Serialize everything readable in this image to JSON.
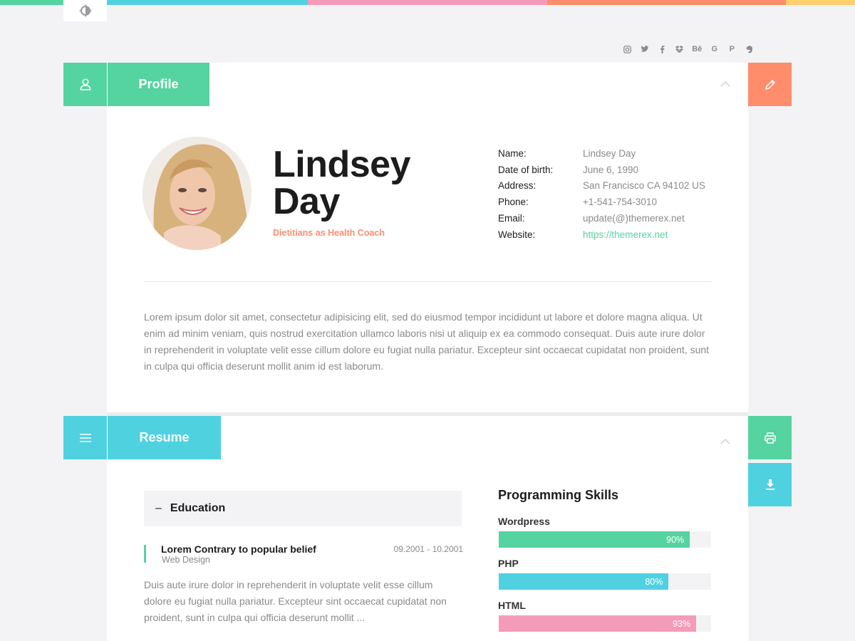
{
  "colors": {
    "green": "#55d3a0",
    "cyan": "#4fd1e0",
    "pink": "#f59bba",
    "orange": "#ff8c6b",
    "yellow": "#ffcf6b"
  },
  "top_bar_segments": [
    "green",
    "white",
    "cyan",
    "pink",
    "orange",
    "yellow"
  ],
  "theme_toggle": {
    "icon": "contrast-icon"
  },
  "socials": [
    "instagram-icon",
    "twitter-icon",
    "facebook-icon",
    "dropbox-icon",
    "behance-icon",
    "google-icon",
    "pinterest-icon",
    "evernote-icon"
  ],
  "socials_text": {
    "behance": "Bē",
    "google": "G",
    "pinterest": "P"
  },
  "profile": {
    "tab_label": "Profile",
    "first_name": "Lindsey",
    "last_name": "Day",
    "role": "Dietitians as Health Coach",
    "info": [
      {
        "key": "Name:",
        "value": "Lindsey Day"
      },
      {
        "key": "Date of birth:",
        "value": "June 6, 1990"
      },
      {
        "key": "Address:",
        "value": "San Francisco CA 94102 US"
      },
      {
        "key": "Phone:",
        "value": "+1-541-754-3010"
      },
      {
        "key": "Email:",
        "value": "update(@)themerex.net"
      },
      {
        "key": "Website:",
        "value": "https://themerex.net"
      }
    ],
    "bio": "Lorem ipsum dolor sit amet, consectetur adipisicing elit, sed do eiusmod tempor incididunt ut labore et dolore magna aliqua. Ut enim ad minim veniam, quis nostrud exercitation ullamco laboris nisi ut aliquip ex ea commodo consequat. Duis aute irure dolor in reprehenderit in voluptate velit esse cillum dolore eu fugiat nulla pariatur. Excepteur sint occaecat cupidatat non proident, sunt in culpa qui officia deserunt mollit anim id est laborum."
  },
  "resume": {
    "tab_label": "Resume",
    "education": {
      "dash": "–",
      "heading": "Education",
      "item": {
        "title": "Lorem Contrary to popular belief",
        "subtitle": "Web Design",
        "date": "09.2001 - 10.2001",
        "text": "Duis aute irure dolor in reprehenderit in voluptate velit esse cillum dolore eu fugiat nulla pariatur. Excepteur sint occaecat cupidatat non proident, sunt in culpa qui officia deserunt mollit ..."
      }
    },
    "skills": {
      "title": "Programming Skills",
      "items": [
        {
          "label": "Wordpress",
          "percent": 90,
          "percent_text": "90%",
          "color": "#55d3a0"
        },
        {
          "label": "PHP",
          "percent": 80,
          "percent_text": "80%",
          "color": "#4fd1e0"
        },
        {
          "label": "HTML",
          "percent": 93,
          "percent_text": "93%",
          "color": "#f59bba"
        }
      ]
    }
  }
}
